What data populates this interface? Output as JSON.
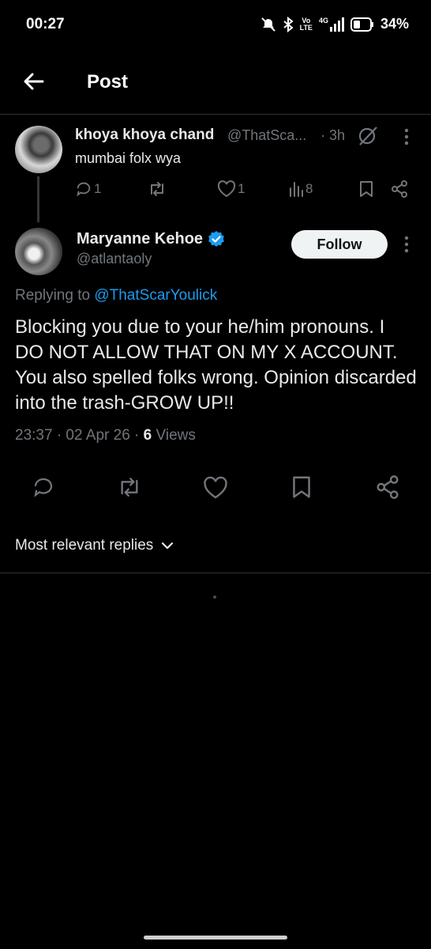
{
  "status_bar": {
    "time": "00:27",
    "volte_top": "Vo",
    "volte_bottom": "LTE",
    "network": "4G",
    "battery": "34%"
  },
  "header": {
    "title": "Post",
    "back_icon": "arrow-left-icon"
  },
  "parent_post": {
    "name": "khoya khoya chand",
    "handle": "@ThatSca...",
    "time": "· 3h",
    "text": "mumbai folx wya",
    "replies": "1",
    "reposts": "",
    "likes": "1",
    "views": "8"
  },
  "main_post": {
    "name": "Maryanne Kehoe",
    "handle": "@atlantaoly",
    "follow_label": "Follow",
    "replying_prefix": "Replying to",
    "replying_to": "@ThatScarYoulick",
    "text": "Blocking you due to your he/him pronouns. I DO NOT ALLOW THAT ON MY X ACCOUNT. You also spelled folks wrong. Opinion discarded into the trash-GROW UP!!",
    "timestamp": "23:37 · 02 Apr 26 ·",
    "views_count": "6",
    "views_label": "Views"
  },
  "replies_sort": {
    "label": "Most relevant replies"
  },
  "colors": {
    "accent": "#1d9bf0",
    "muted": "#71767b",
    "text": "#e7e9ea",
    "background": "#000000"
  }
}
